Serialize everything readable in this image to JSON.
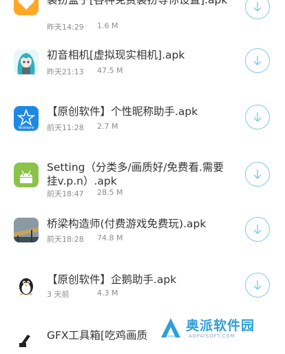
{
  "apps": [
    {
      "name": "装扮盒子[各种免费装扮等你设置].apk",
      "time": "昨天14:29",
      "size": "1.6 M",
      "icon": "heart-icon",
      "icon_color": "#ffa726"
    },
    {
      "name": "初音相机[虚拟现实相机].apk",
      "time": "昨天21:13",
      "size": "47.5 M",
      "icon": "miku-avatar-icon",
      "icon_color": "#2bb3c0"
    },
    {
      "name": "【原创软件】个性昵称助手.apk",
      "time": "前天11:28",
      "size": "2.7 M",
      "icon": "nickname-star-icon",
      "icon_color": "#1e88e5"
    },
    {
      "name": "Setting（分类多/画质好/免费看.需要挂v.p.n）.apk",
      "time": "前天18:47",
      "size": "28.5 M",
      "icon": "android-icon",
      "icon_color": "#8bc34a"
    },
    {
      "name": "桥梁构造师(付费游戏免费玩).apk",
      "time": "前天18:28",
      "size": "74.8 M",
      "icon": "bridge-photo-icon",
      "icon_color": "#5d6d78"
    },
    {
      "name": "【原创软件】企鹅助手.apk",
      "time": "3 天前",
      "size": "4.3 M",
      "icon": "penguin-icon",
      "icon_color": "#222222"
    },
    {
      "name": "GFX工具箱[吃鸡画质",
      "time": "",
      "size": "",
      "icon": "gfx-toolbox-icon",
      "icon_color": "#222222"
    }
  ],
  "icon_texts": {
    "nickname": "NickName"
  },
  "watermark": {
    "cn": "奥派软件园",
    "en": "AOPAISOFT.COM"
  },
  "colors": {
    "accent": "#7ec8ea",
    "text": "#333333",
    "meta": "#8c8c8c",
    "watermark": "#2f9fd8"
  }
}
